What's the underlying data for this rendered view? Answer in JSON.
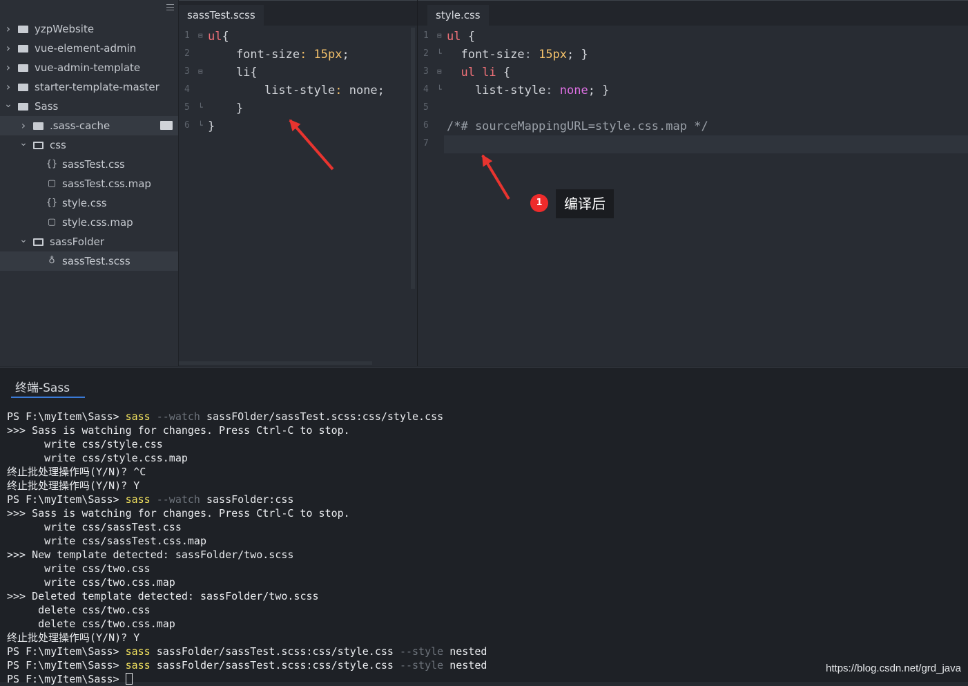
{
  "sidebar": {
    "items": [
      {
        "label": "yzpWebsite",
        "depth": 0,
        "type": "project",
        "expanded": false
      },
      {
        "label": "vue-element-admin",
        "depth": 0,
        "type": "project",
        "expanded": false
      },
      {
        "label": "vue-admin-template",
        "depth": 0,
        "type": "project",
        "expanded": false
      },
      {
        "label": "starter-template-master",
        "depth": 0,
        "type": "project",
        "expanded": false
      },
      {
        "label": "Sass",
        "depth": 0,
        "type": "project",
        "expanded": true
      },
      {
        "label": ".sass-cache",
        "depth": 1,
        "type": "folder",
        "expanded": false
      },
      {
        "label": "css",
        "depth": 1,
        "type": "folder",
        "expanded": true
      },
      {
        "label": "sassTest.css",
        "depth": 2,
        "type": "css-file"
      },
      {
        "label": "sassTest.css.map",
        "depth": 2,
        "type": "file"
      },
      {
        "label": "style.css",
        "depth": 2,
        "type": "css-file"
      },
      {
        "label": "style.css.map",
        "depth": 2,
        "type": "file"
      },
      {
        "label": "sassFolder",
        "depth": 1,
        "type": "folder",
        "expanded": true
      },
      {
        "label": "sassTest.scss",
        "depth": 2,
        "type": "scss-file",
        "selected": true
      }
    ]
  },
  "editor_left": {
    "tab": "sassTest.scss",
    "line_numbers": [
      "1",
      "2",
      "3",
      "4",
      "5",
      "6"
    ],
    "lines": [
      {
        "t": [
          {
            "s": "ul",
            "c": "sel"
          },
          {
            "s": "{",
            "c": ""
          }
        ]
      },
      {
        "t": [
          {
            "s": "    font-size",
            "c": ""
          },
          {
            "s": ": ",
            "c": "num"
          },
          {
            "s": "15px",
            "c": "num"
          },
          {
            "s": ";",
            "c": ""
          }
        ]
      },
      {
        "t": [
          {
            "s": "    li{",
            "c": ""
          }
        ]
      },
      {
        "t": [
          {
            "s": "        list-style",
            "c": ""
          },
          {
            "s": ": ",
            "c": "num"
          },
          {
            "s": "none;",
            "c": ""
          }
        ]
      },
      {
        "t": [
          {
            "s": "    }",
            "c": ""
          }
        ]
      },
      {
        "t": [
          {
            "s": "}",
            "c": ""
          }
        ]
      }
    ]
  },
  "editor_right": {
    "tab": "style.css",
    "line_numbers": [
      "1",
      "2",
      "3",
      "4",
      "5",
      "6",
      "7"
    ],
    "lines": [
      {
        "t": [
          {
            "s": "ul",
            "c": "sel"
          },
          {
            "s": " {",
            "c": ""
          }
        ]
      },
      {
        "t": [
          {
            "s": "  font-size",
            "c": ""
          },
          {
            "s": ": ",
            "c": "gray"
          },
          {
            "s": "15px",
            "c": "num"
          },
          {
            "s": "; }",
            "c": ""
          }
        ]
      },
      {
        "t": [
          {
            "s": "  ul li",
            "c": "sel"
          },
          {
            "s": " {",
            "c": ""
          }
        ]
      },
      {
        "t": [
          {
            "s": "    list-style",
            "c": ""
          },
          {
            "s": ": ",
            "c": "gray"
          },
          {
            "s": "none",
            "c": "val"
          },
          {
            "s": "; }",
            "c": ""
          }
        ]
      },
      {
        "t": []
      },
      {
        "t": [
          {
            "s": "/*# sourceMappingURL=style.css.map */",
            "c": "com"
          }
        ]
      },
      {
        "t": []
      }
    ]
  },
  "annotation": {
    "number": "1",
    "text": "编译后"
  },
  "terminal": {
    "tab": "终端-Sass",
    "lines": [
      [
        {
          "s": "PS F:\\myItem\\Sass> ",
          "c": ""
        },
        {
          "s": "sass ",
          "c": "cmd"
        },
        {
          "s": "--watch ",
          "c": "flag"
        },
        {
          "s": "sassFOlder/sassTest.scss:css/style.css",
          "c": ""
        }
      ],
      [
        {
          "s": ">>> Sass is watching for changes. Press Ctrl-C to stop.",
          "c": ""
        }
      ],
      [
        {
          "s": "      write css/style.css",
          "c": ""
        }
      ],
      [
        {
          "s": "      write css/style.css.map",
          "c": ""
        }
      ],
      [
        {
          "s": "终止批处理操作吗(Y/N)? ^C",
          "c": ""
        }
      ],
      [
        {
          "s": "终止批处理操作吗(Y/N)? Y",
          "c": ""
        }
      ],
      [
        {
          "s": "PS F:\\myItem\\Sass> ",
          "c": ""
        },
        {
          "s": "sass ",
          "c": "cmd"
        },
        {
          "s": "--watch ",
          "c": "flag"
        },
        {
          "s": "sassFolder:css",
          "c": ""
        }
      ],
      [
        {
          "s": ">>> Sass is watching for changes. Press Ctrl-C to stop.",
          "c": ""
        }
      ],
      [
        {
          "s": "      write css/sassTest.css",
          "c": ""
        }
      ],
      [
        {
          "s": "      write css/sassTest.css.map",
          "c": ""
        }
      ],
      [
        {
          "s": ">>> New template detected: sassFolder/two.scss",
          "c": ""
        }
      ],
      [
        {
          "s": "      write css/two.css",
          "c": ""
        }
      ],
      [
        {
          "s": "      write css/two.css.map",
          "c": ""
        }
      ],
      [
        {
          "s": ">>> Deleted template detected: sassFolder/two.scss",
          "c": ""
        }
      ],
      [
        {
          "s": "     delete css/two.css",
          "c": ""
        }
      ],
      [
        {
          "s": "     delete css/two.css.map",
          "c": ""
        }
      ],
      [
        {
          "s": "终止批处理操作吗(Y/N)? Y",
          "c": ""
        }
      ],
      [
        {
          "s": "PS F:\\myItem\\Sass> ",
          "c": ""
        },
        {
          "s": "sass ",
          "c": "cmd"
        },
        {
          "s": "sassFolder/sassTest.scss:css/style.css ",
          "c": ""
        },
        {
          "s": "--style ",
          "c": "flag"
        },
        {
          "s": "nested",
          "c": ""
        }
      ],
      [
        {
          "s": "PS F:\\myItem\\Sass> ",
          "c": ""
        },
        {
          "s": "sass ",
          "c": "cmd"
        },
        {
          "s": "sassFolder/sassTest.scss:css/style.css ",
          "c": ""
        },
        {
          "s": "--style ",
          "c": "flag"
        },
        {
          "s": "nested",
          "c": ""
        }
      ],
      [
        {
          "s": "PS F:\\myItem\\Sass> ",
          "c": ""
        },
        {
          "s": "",
          "c": "cursor"
        }
      ]
    ]
  },
  "watermark": "https://blog.csdn.net/grd_java",
  "colors": {
    "selector": "#f07178",
    "number": "#f5c26b",
    "value": "#e171e6",
    "command": "#f3e35f",
    "arrow": "#e8342f",
    "accent": "#3a7ad6"
  }
}
